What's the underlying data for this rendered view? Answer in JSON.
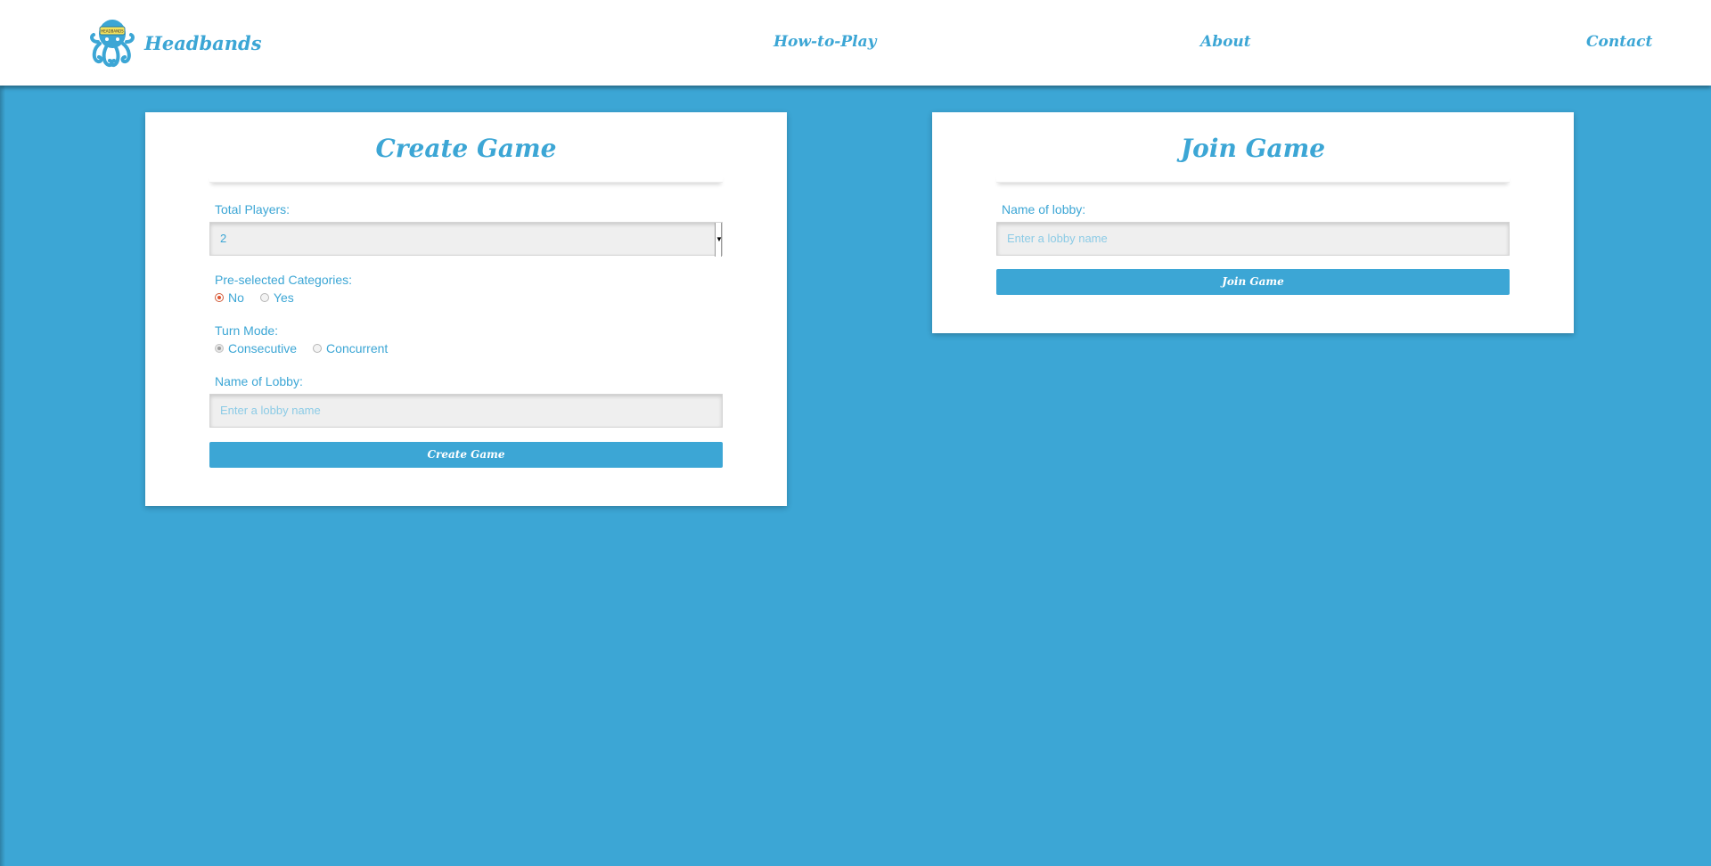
{
  "header": {
    "brand": "Headbands",
    "logo_badge": "HEADBANDS",
    "nav": [
      "How-to-Play",
      "About",
      "Contact"
    ]
  },
  "create_game": {
    "title": "Create Game",
    "total_players_label": "Total Players:",
    "total_players_value": "2",
    "categories_label": "Pre-selected Categories:",
    "categories_options": [
      "No",
      "Yes"
    ],
    "categories_selected": "No",
    "turn_mode_label": "Turn Mode:",
    "turn_mode_options": [
      "Consecutive",
      "Concurrent"
    ],
    "turn_mode_selected": "Consecutive",
    "lobby_label": "Name of Lobby:",
    "lobby_placeholder": "Enter a lobby name",
    "button": "Create Game"
  },
  "join_game": {
    "title": "Join Game",
    "lobby_label": "Name of lobby:",
    "lobby_placeholder": "Enter a lobby name",
    "button": "Join Game"
  },
  "colors": {
    "background": "#3ca6d5",
    "accent": "#3ca6d5",
    "radio_selected": "#e0532f"
  }
}
